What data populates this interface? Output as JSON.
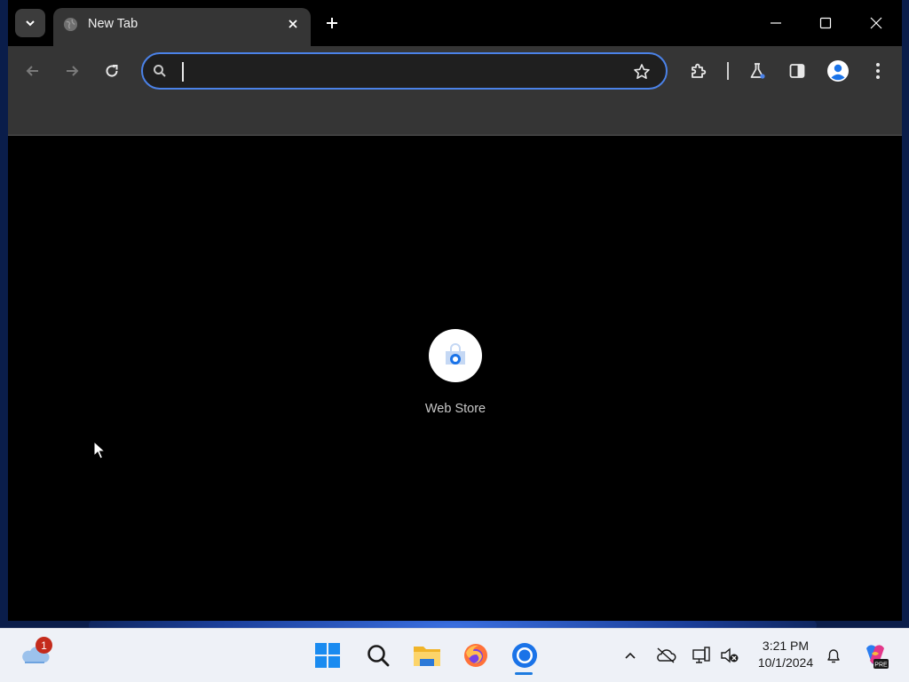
{
  "browser": {
    "tab": {
      "title": "New Tab"
    },
    "omnibox": {
      "value": "",
      "placeholder": ""
    },
    "accent_color": "#4b82e8",
    "icons": [
      "tab-search-icon",
      "globe-icon",
      "close-icon",
      "plus-icon",
      "minimize-icon",
      "maximize-icon",
      "window-close-icon",
      "back-arrow-icon",
      "forward-arrow-icon",
      "reload-icon",
      "search-icon",
      "star-icon",
      "puzzle-icon",
      "flask-icon",
      "side-panel-icon",
      "profile-icon",
      "kebab-menu-icon"
    ]
  },
  "new_tab_page": {
    "shortcuts": [
      {
        "label": "Web Store",
        "icon": "web-store-icon"
      }
    ]
  },
  "taskbar": {
    "weather_badge": "1",
    "apps": [
      "start",
      "search",
      "file-explorer",
      "firefox",
      "chrome"
    ],
    "time": "3:21 PM",
    "date": "10/1/2024"
  }
}
